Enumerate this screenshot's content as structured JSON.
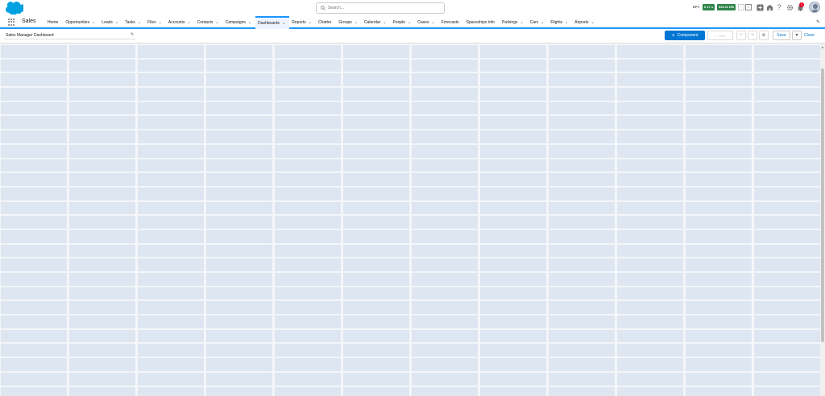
{
  "header": {
    "search_placeholder": "Search...",
    "ept_label": "EPT:",
    "ept_value": "0.17 s",
    "ept_size": "626.11 KB",
    "notification_count": "1"
  },
  "nav": {
    "app_name": "Sales",
    "tabs": [
      {
        "label": "Home",
        "chevron": false
      },
      {
        "label": "Opportunities",
        "chevron": true
      },
      {
        "label": "Leads",
        "chevron": true
      },
      {
        "label": "Tasks",
        "chevron": true
      },
      {
        "label": "Files",
        "chevron": true
      },
      {
        "label": "Accounts",
        "chevron": true
      },
      {
        "label": "Contacts",
        "chevron": true
      },
      {
        "label": "Campaigns",
        "chevron": true
      },
      {
        "label": "Dashboards",
        "chevron": true,
        "active": true
      },
      {
        "label": "Reports",
        "chevron": true
      },
      {
        "label": "Chatter",
        "chevron": false
      },
      {
        "label": "Groups",
        "chevron": true
      },
      {
        "label": "Calendar",
        "chevron": true
      },
      {
        "label": "People",
        "chevron": true
      },
      {
        "label": "Cases",
        "chevron": true
      },
      {
        "label": "Forecasts",
        "chevron": false
      },
      {
        "label": "Spaceships info",
        "chevron": false
      },
      {
        "label": "Parkings",
        "chevron": true
      },
      {
        "label": "Cars",
        "chevron": true
      },
      {
        "label": "Flights",
        "chevron": true
      },
      {
        "label": "Airports",
        "chevron": true
      }
    ]
  },
  "toolbar": {
    "dashboard_name": "Sales Manager Dashboard",
    "component_label": "Component",
    "filter_label": "Filter",
    "save_label": "Save",
    "clone_label": "Clone"
  },
  "colors": {
    "brand": "#0176d3",
    "accent": "#1b96ff",
    "grid_cell": "#dde6f1",
    "success": "#2e844a"
  },
  "icons": [
    "salesforce-cloud-icon",
    "search-icon",
    "app-launcher-icon",
    "chevron-down-icon",
    "pencil-icon",
    "plus-icon",
    "undo-icon",
    "redo-icon",
    "gear-icon",
    "help-icon",
    "bell-icon",
    "add-icon",
    "setup-icon"
  ]
}
